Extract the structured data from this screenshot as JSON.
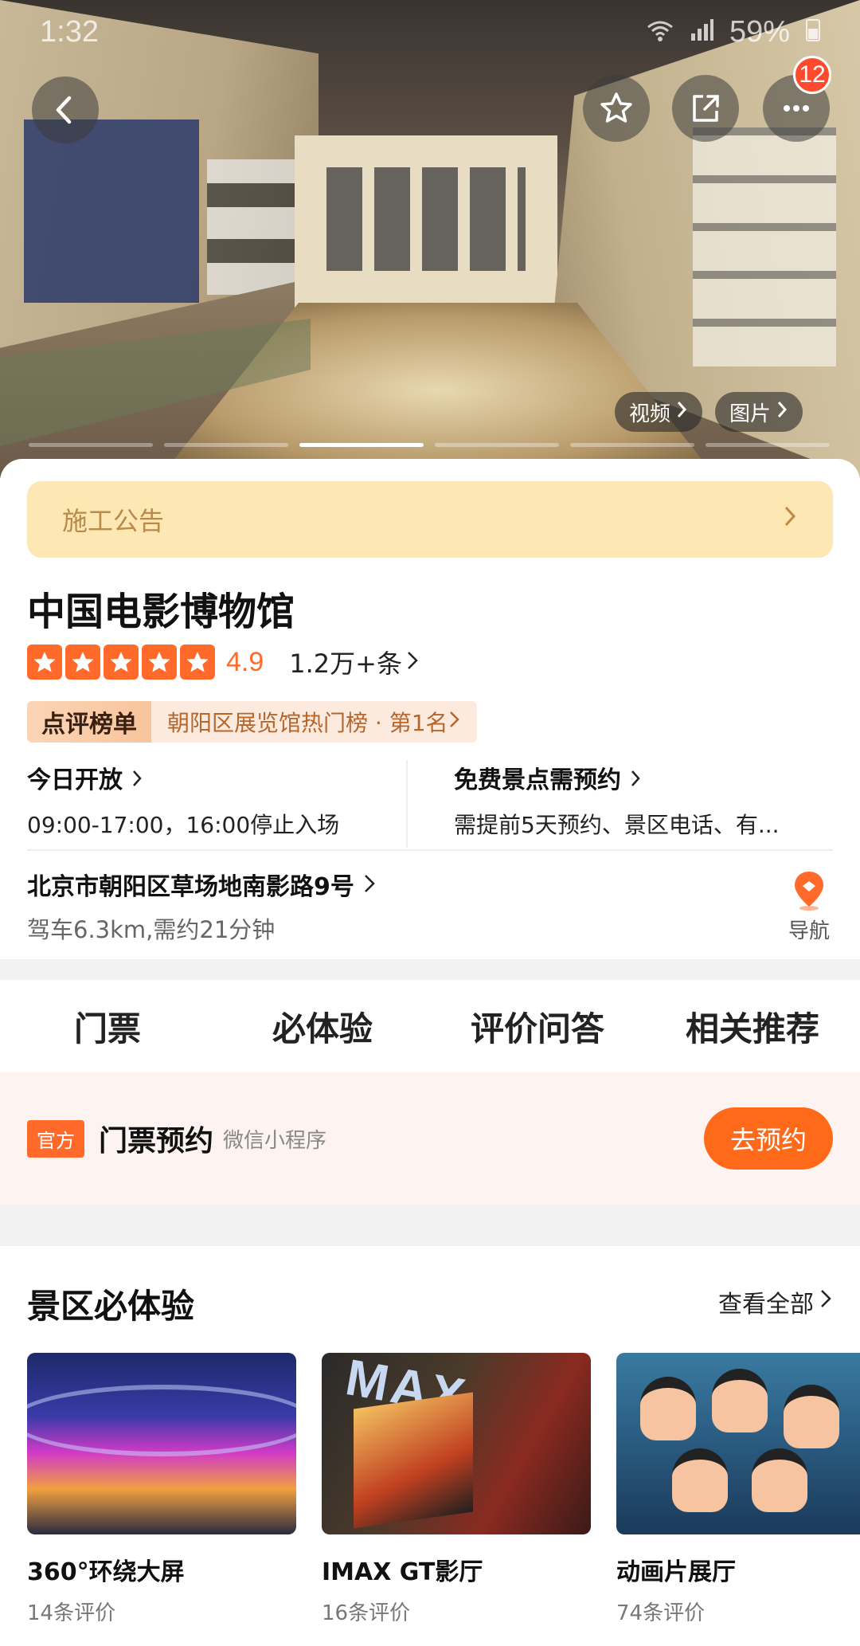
{
  "status": {
    "time": "1:32",
    "battery": "59%"
  },
  "hero": {
    "media": {
      "video_label": "视频",
      "photo_label": "图片"
    },
    "badge_count": "12",
    "progress": {
      "total": 6,
      "active_index": 2
    }
  },
  "notice": {
    "label": "施工公告"
  },
  "poi": {
    "title": "中国电影博物馆",
    "rating": "4.9",
    "review_count": "1.2万+条",
    "rank": {
      "badge": "点评榜单",
      "text": "朝阳区展览馆热门榜 · 第1名"
    },
    "open": {
      "heading": "今日开放",
      "hours": "09:00-17:00，16:00停止入场"
    },
    "reserve": {
      "heading": "免费景点需预约",
      "detail": "需提前5天预约、景区电话、有..."
    },
    "address": "北京市朝阳区草场地南影路9号",
    "drive": "驾车6.3km,需约21分钟",
    "nav_label": "导航"
  },
  "tabs": [
    {
      "label": "门票",
      "active": true
    },
    {
      "label": "必体验",
      "active": false
    },
    {
      "label": "评价问答",
      "active": false
    },
    {
      "label": "相关推荐",
      "active": false
    }
  ],
  "ticket": {
    "official": "官方",
    "name": "门票预约",
    "sub": "微信小程序",
    "book_label": "去预约"
  },
  "experience": {
    "heading": "景区必体验",
    "view_all": "查看全部",
    "items": [
      {
        "name": "360°环绕大屏",
        "reviews": "14条评价"
      },
      {
        "name": "IMAX GT影厅",
        "reviews": "16条评价"
      },
      {
        "name": "动画片展厅",
        "reviews": "74条评价"
      }
    ]
  },
  "colors": {
    "accent": "#ff6a2a",
    "notice_bg": "#fde8b4",
    "ticket_bg": "#fdf3f0"
  }
}
